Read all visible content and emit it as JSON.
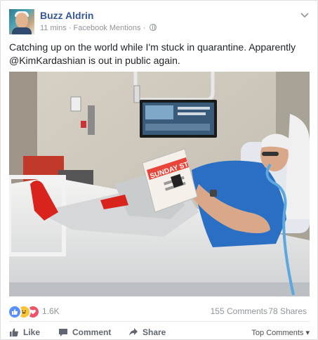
{
  "post": {
    "author": "Buzz Aldrin",
    "time": "11 mins",
    "source": "Facebook Mentions",
    "separator": "·",
    "text_line1": "Catching up on the world while I'm stuck in quarantine. Apparently",
    "text_line2": "@KimKardashian is out in public again.",
    "newspaper_masthead": "SUNDAY ST",
    "menu_icon": "chevron-down-icon"
  },
  "reactions": {
    "icons": [
      "like",
      "haha",
      "love"
    ],
    "count": "1.6K",
    "comments": "155 Comments",
    "shares": "78 Shares"
  },
  "actions": {
    "like": "Like",
    "comment": "Comment",
    "share": "Share",
    "top_comments": "Top Comments"
  },
  "colors": {
    "name_blue": "#365899",
    "meta_gray": "#90949c",
    "like_blue": "#5890ff",
    "love_red": "#f25268",
    "haha_yellow": "#f7c536"
  }
}
